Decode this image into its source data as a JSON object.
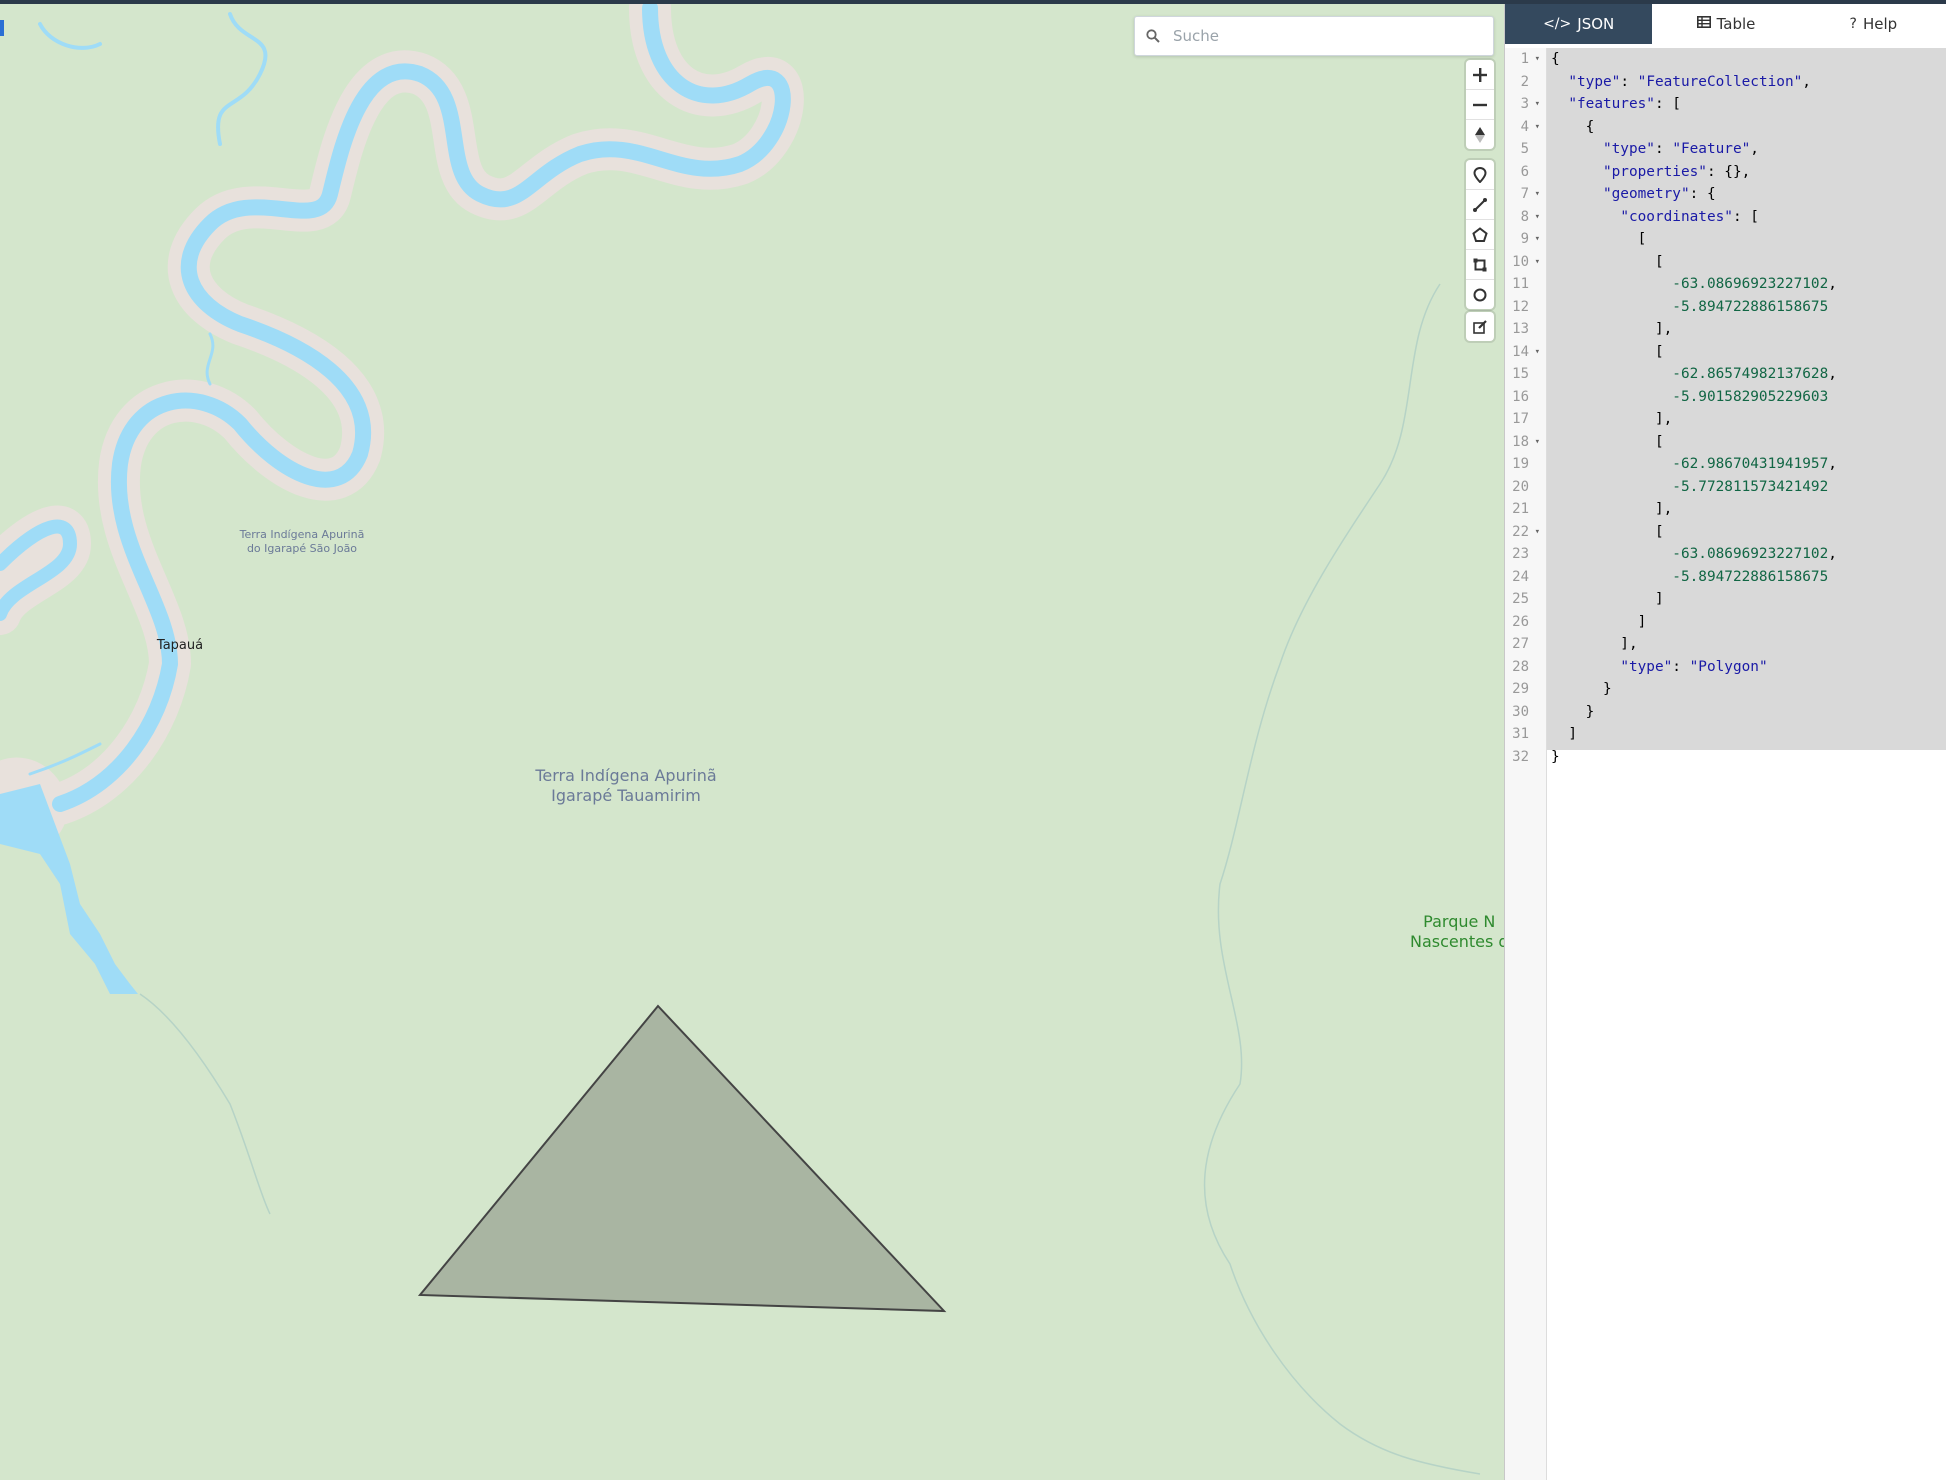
{
  "map": {
    "search": {
      "placeholder": "Suche",
      "value": ""
    },
    "labels": {
      "territory_small": [
        "Terra Indígena Apurinã",
        "do Igarapé São João"
      ],
      "town": "Tapauá",
      "territory_big": [
        "Terra Indígena Apurinã",
        "Igarapé Tauamirim"
      ],
      "park": [
        "Parque N",
        "Nascentes d"
      ]
    },
    "zoom_controls": [
      "zoom-in",
      "zoom-out",
      "reset-north"
    ],
    "draw_controls": [
      "draw-point",
      "draw-line",
      "draw-polygon",
      "draw-rectangle",
      "draw-circle"
    ],
    "edit_control": "edit-features",
    "colors": {
      "land": "#d4e6cc",
      "water": "#9fdcf7",
      "bank": "#e8e1dc",
      "polygon_fill": "#a9b5a2",
      "polygon_stroke": "#444444"
    }
  },
  "sidebar": {
    "tabs": [
      {
        "label": "JSON",
        "icon": "code-icon",
        "active": true
      },
      {
        "label": "Table",
        "icon": "table-icon",
        "active": false
      },
      {
        "label": "Help",
        "icon": "question-icon",
        "active": false
      }
    ],
    "editor_lines": [
      "{",
      "  \"type\": \"FeatureCollection\",",
      "  \"features\": [",
      "    {",
      "      \"type\": \"Feature\",",
      "      \"properties\": {},",
      "      \"geometry\": {",
      "        \"coordinates\": [",
      "          [",
      "            [",
      "              -63.08696923227102,",
      "              -5.894722886158675",
      "            ],",
      "            [",
      "              -62.86574982137628,",
      "              -5.901582905229603",
      "            ],",
      "            [",
      "              -62.98670431941957,",
      "              -5.772811573421492",
      "            ],",
      "            [",
      "              -63.08696923227102,",
      "              -5.894722886158675",
      "            ]",
      "          ]",
      "        ],",
      "        \"type\": \"Polygon\"",
      "      }",
      "    }",
      "  ]",
      "}"
    ],
    "fold_lines": [
      1,
      3,
      4,
      7,
      8,
      9,
      10,
      14,
      18,
      22
    ]
  }
}
